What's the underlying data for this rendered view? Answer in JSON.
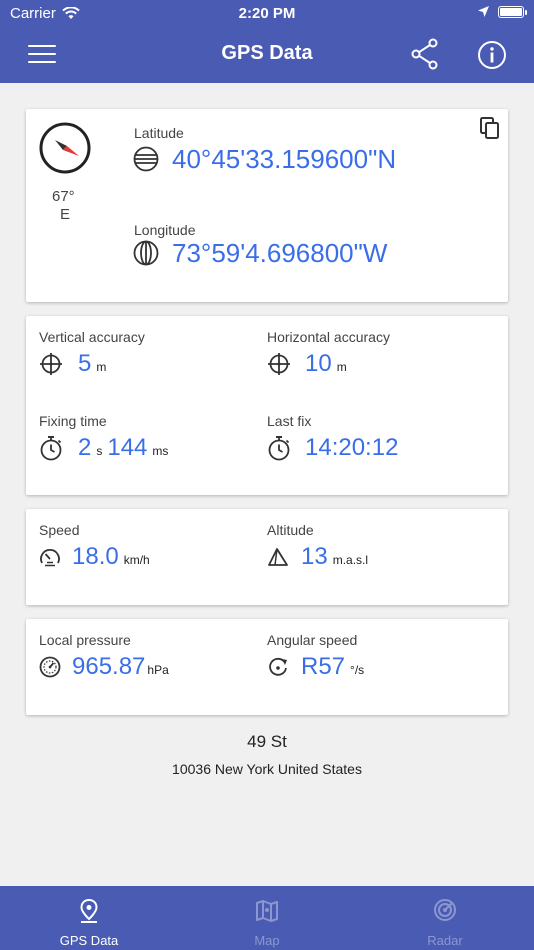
{
  "status_bar": {
    "carrier": "Carrier",
    "time": "2:20 PM"
  },
  "app_bar": {
    "title": "GPS Data"
  },
  "coordinates": {
    "heading_degrees": "67°",
    "heading_direction": "E",
    "latitude_label": "Latitude",
    "latitude_value": "40°45'33.159600\"N",
    "longitude_label": "Longitude",
    "longitude_value": "73°59'4.696800\"W"
  },
  "accuracy": {
    "vertical_label": "Vertical accuracy",
    "vertical_value": "5",
    "vertical_unit": "m",
    "horizontal_label": "Horizontal accuracy",
    "horizontal_value": "10",
    "horizontal_unit": "m",
    "fixing_label": "Fixing time",
    "fixing_seconds": "2",
    "fixing_seconds_unit": "s",
    "fixing_ms": "144",
    "fixing_ms_unit": "ms",
    "last_fix_label": "Last fix",
    "last_fix_value": "14:20:12"
  },
  "motion": {
    "speed_label": "Speed",
    "speed_value": "18.0",
    "speed_unit": "km/h",
    "altitude_label": "Altitude",
    "altitude_value": "13",
    "altitude_unit": "m.a.s.l"
  },
  "environment": {
    "pressure_label": "Local pressure",
    "pressure_value": "965.87",
    "pressure_unit": "hPa",
    "angular_label": "Angular speed",
    "angular_value": "R57",
    "angular_unit": "°/s"
  },
  "address": {
    "street": "49 St",
    "city_line": "10036 New York United States"
  },
  "tabs": [
    {
      "label": "GPS Data",
      "icon": "location-pin-icon"
    },
    {
      "label": "Map",
      "icon": "map-icon"
    },
    {
      "label": "Radar",
      "icon": "radar-icon"
    }
  ],
  "colors": {
    "primary": "#4a5bb3",
    "accent": "#3a6ee8",
    "compass_red": "#e53935",
    "inactive_tab": "#8c97cf"
  }
}
